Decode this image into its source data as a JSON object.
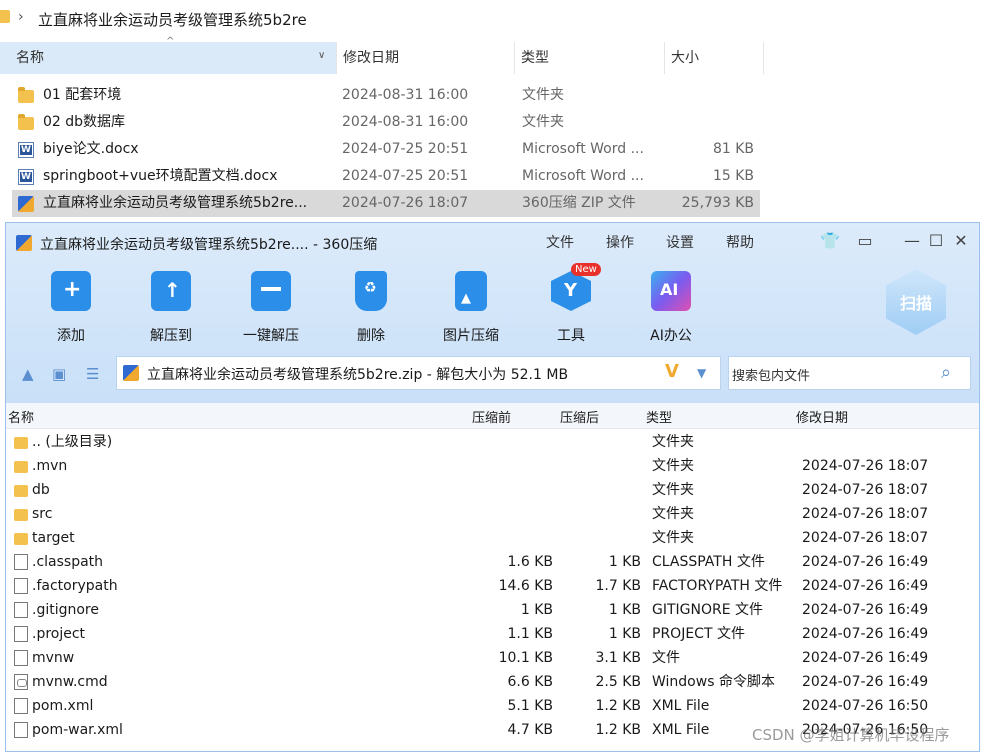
{
  "explorer": {
    "breadcrumb": "立直麻将业余运动员考级管理系统5b2re",
    "columns": {
      "name": "名称",
      "date": "修改日期",
      "type": "类型",
      "size": "大小"
    },
    "rows": [
      {
        "name": "01 配套环境",
        "date": "2024-08-31 16:00",
        "type": "文件夹",
        "size": "",
        "icon": "folder-icon"
      },
      {
        "name": "02 db数据库",
        "date": "2024-08-31 16:00",
        "type": "文件夹",
        "size": "",
        "icon": "folder-icon"
      },
      {
        "name": "biye论文.docx",
        "date": "2024-07-25 20:51",
        "type": "Microsoft Word ...",
        "size": "81 KB",
        "icon": "word-doc-icon"
      },
      {
        "name": "springboot+vue环境配置文档.docx",
        "date": "2024-07-25 20:51",
        "type": "Microsoft Word ...",
        "size": "15 KB",
        "icon": "word-doc-icon"
      },
      {
        "name": "立直麻将业余运动员考级管理系统5b2re...",
        "date": "2024-07-26 18:07",
        "type": "360压缩 ZIP 文件",
        "size": "25,793 KB",
        "icon": "zip-archive-icon"
      }
    ]
  },
  "zip": {
    "title": "立直麻将业余运动员考级管理系统5b2re.... - 360压缩",
    "menu": [
      "文件",
      "操作",
      "设置",
      "帮助"
    ],
    "toolbar": [
      {
        "label": "添加",
        "icon": "add-icon"
      },
      {
        "label": "解压到",
        "icon": "extract-to-icon"
      },
      {
        "label": "一键解压",
        "icon": "one-click-extract-icon"
      },
      {
        "label": "删除",
        "icon": "trash-icon"
      },
      {
        "label": "图片压缩",
        "icon": "image-compress-icon"
      },
      {
        "label": "工具",
        "icon": "tools-icon"
      },
      {
        "label": "AI办公",
        "icon": "ai-office-icon"
      }
    ],
    "new_badge": "New",
    "scan_label": "扫描",
    "ai_text": "AI",
    "address": "立直麻将业余运动员考级管理系统5b2re.zip - 解包大小为 52.1 MB",
    "search_placeholder": "搜索包内文件",
    "columns": {
      "name": "名称",
      "before": "压缩前",
      "after": "压缩后",
      "type": "类型",
      "date": "修改日期"
    },
    "rows": [
      {
        "name": ".. (上级目录)",
        "before": "",
        "after": "",
        "type": "文件夹",
        "date": "",
        "icon": "folder"
      },
      {
        "name": ".mvn",
        "before": "",
        "after": "",
        "type": "文件夹",
        "date": "2024-07-26 18:07",
        "icon": "folder"
      },
      {
        "name": "db",
        "before": "",
        "after": "",
        "type": "文件夹",
        "date": "2024-07-26 18:07",
        "icon": "folder"
      },
      {
        "name": "src",
        "before": "",
        "after": "",
        "type": "文件夹",
        "date": "2024-07-26 18:07",
        "icon": "folder"
      },
      {
        "name": "target",
        "before": "",
        "after": "",
        "type": "文件夹",
        "date": "2024-07-26 18:07",
        "icon": "folder"
      },
      {
        "name": ".classpath",
        "before": "1.6 KB",
        "after": "1 KB",
        "type": "CLASSPATH 文件",
        "date": "2024-07-26 16:49",
        "icon": "file"
      },
      {
        "name": ".factorypath",
        "before": "14.6 KB",
        "after": "1.7 KB",
        "type": "FACTORYPATH 文件",
        "date": "2024-07-26 16:49",
        "icon": "file"
      },
      {
        "name": ".gitignore",
        "before": "1 KB",
        "after": "1 KB",
        "type": "GITIGNORE 文件",
        "date": "2024-07-26 16:49",
        "icon": "file"
      },
      {
        "name": ".project",
        "before": "1.1 KB",
        "after": "1 KB",
        "type": "PROJECT 文件",
        "date": "2024-07-26 16:49",
        "icon": "file"
      },
      {
        "name": "mvnw",
        "before": "10.1 KB",
        "after": "3.1 KB",
        "type": "文件",
        "date": "2024-07-26 16:49",
        "icon": "file"
      },
      {
        "name": "mvnw.cmd",
        "before": "6.6 KB",
        "after": "2.5 KB",
        "type": "Windows 命令脚本",
        "date": "2024-07-26 16:49",
        "icon": "cmd"
      },
      {
        "name": "pom.xml",
        "before": "5.1 KB",
        "after": "1.2 KB",
        "type": "XML File",
        "date": "2024-07-26 16:50",
        "icon": "file"
      },
      {
        "name": "pom-war.xml",
        "before": "4.7 KB",
        "after": "1.2 KB",
        "type": "XML File",
        "date": "2024-07-26 16:50",
        "icon": "file"
      }
    ]
  },
  "watermark": "CSDN @李姐计算机毕设程序"
}
